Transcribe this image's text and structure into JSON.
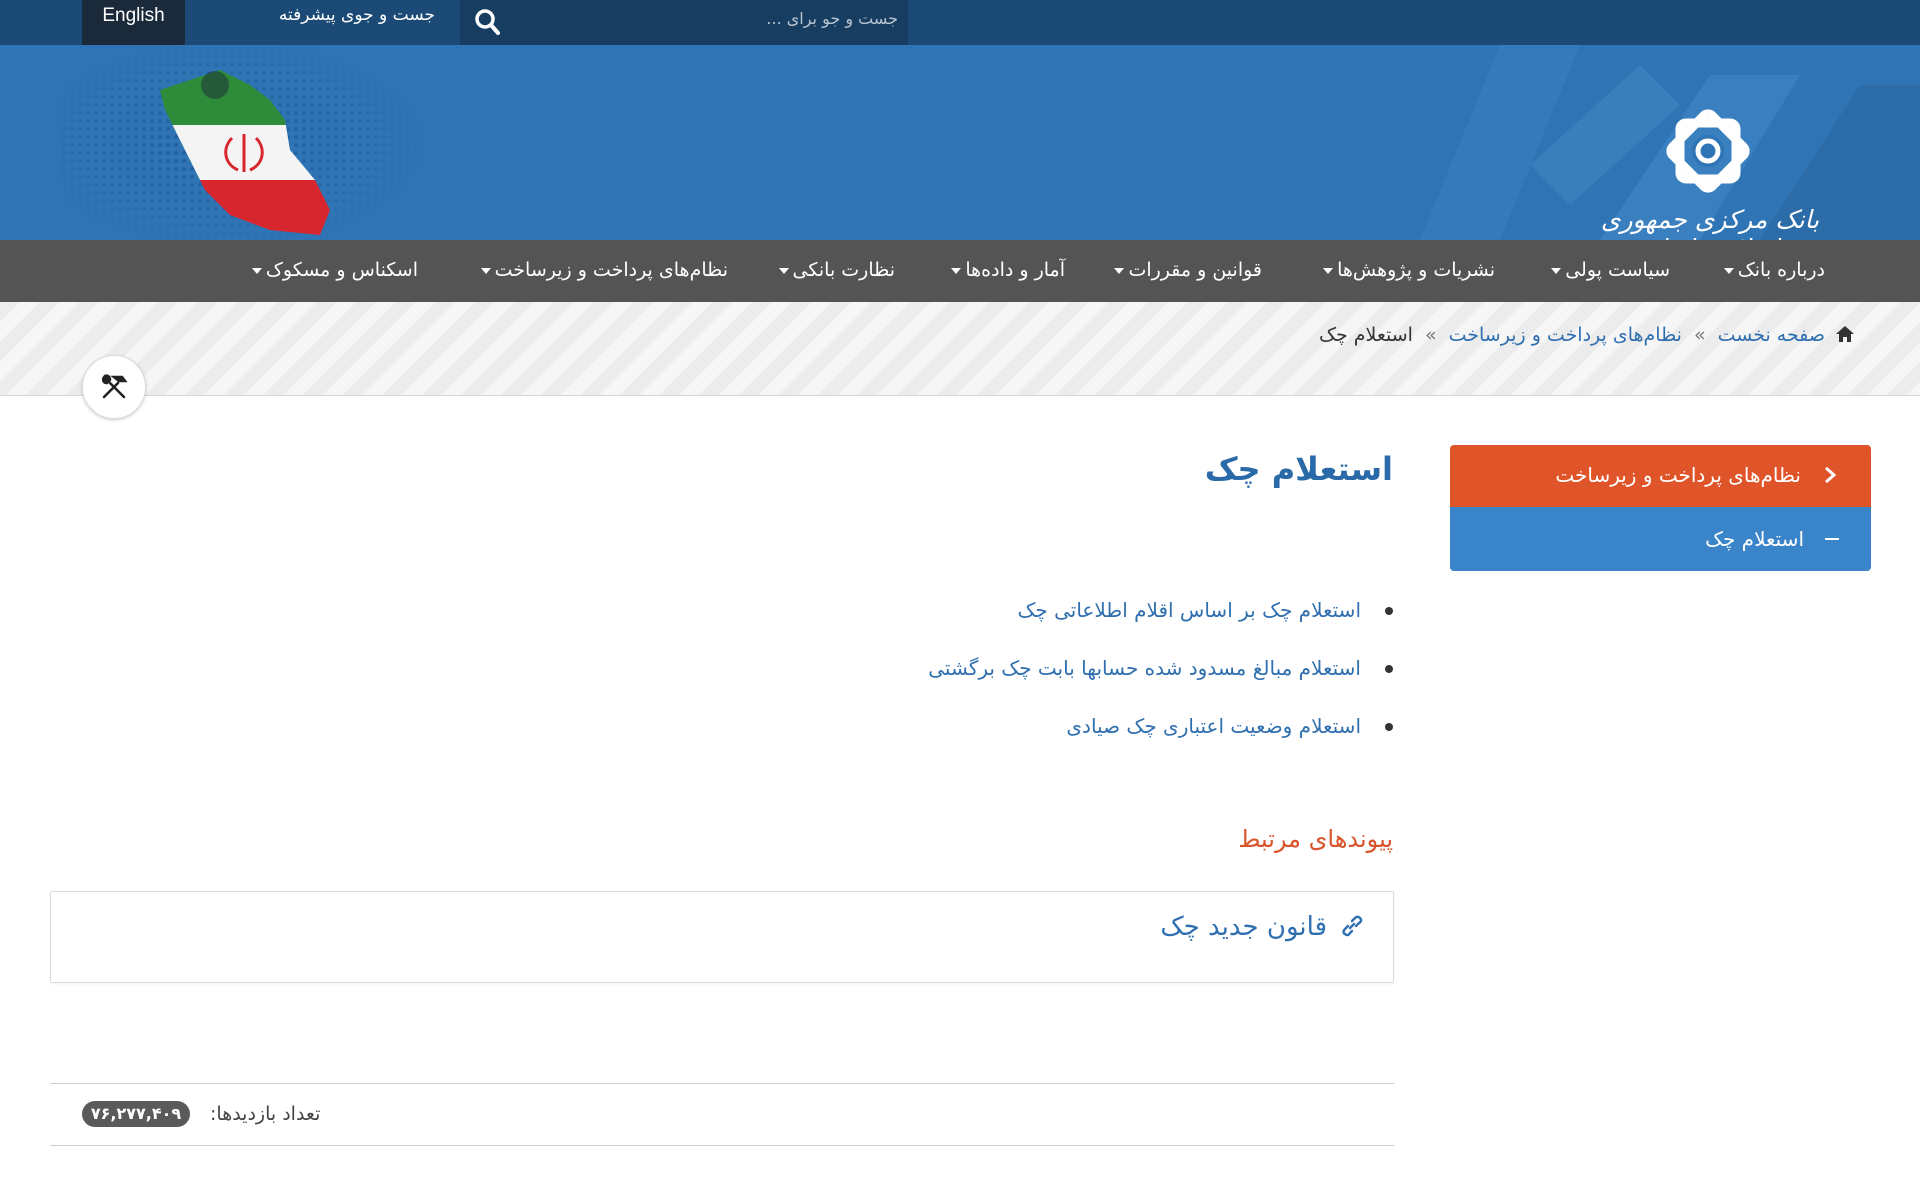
{
  "topbar": {
    "language_button": "English",
    "advanced_search": "جست و جوی پیشرفته",
    "search_placeholder": "جست و جو برای ..."
  },
  "header": {
    "logo_text": "بانک مرکزی جمهوری اسلامی ایران"
  },
  "nav": {
    "items": [
      {
        "label": "درباره بانک"
      },
      {
        "label": "سیاست پولی"
      },
      {
        "label": "نشریات و پژوهش‌ها"
      },
      {
        "label": "قوانین و مقررات"
      },
      {
        "label": "آمار و داده‌ها"
      },
      {
        "label": "نظارت بانکی"
      },
      {
        "label": "نظام‌های پرداخت و زیرساخت"
      },
      {
        "label": "اسکناس و مسکوک"
      }
    ]
  },
  "breadcrumb": {
    "home": "صفحه نخست",
    "section": "نظام‌های پرداخت و زیرساخت",
    "current": "استعلام چک",
    "separator": "»"
  },
  "sidebar": {
    "parent": "نظام‌های پرداخت و زیرساخت",
    "child": "استعلام چک"
  },
  "main": {
    "title": "استعلام چک",
    "links": [
      {
        "label": "استعلام چک بر اساس اقلام اطلاعاتی چک"
      },
      {
        "label": "استعلام مبالغ مسدود شده حسابها بابت چک برگشتی"
      },
      {
        "label": "استعلام وضعیت اعتباری چک صیادی"
      }
    ],
    "related_title": "پیوندهای مرتبط",
    "related_link": "قانون جدید چک"
  },
  "footer": {
    "visits_label": "تعداد بازدیدها:",
    "visits_count": "۷۶,۲۷۷,۴۰۹"
  },
  "colors": {
    "topbar": "#1a4a75",
    "banner": "#2f74b4",
    "nav": "#545454",
    "sidebar_parent": "#e0542a",
    "sidebar_child": "#3a84c9",
    "title": "#2b6aa8",
    "related_title": "#d9532b"
  },
  "icons": [
    "search-icon",
    "home-icon",
    "tools-icon",
    "chevron-right-icon",
    "minus-icon",
    "link-icon",
    "bank-logo-icon"
  ]
}
